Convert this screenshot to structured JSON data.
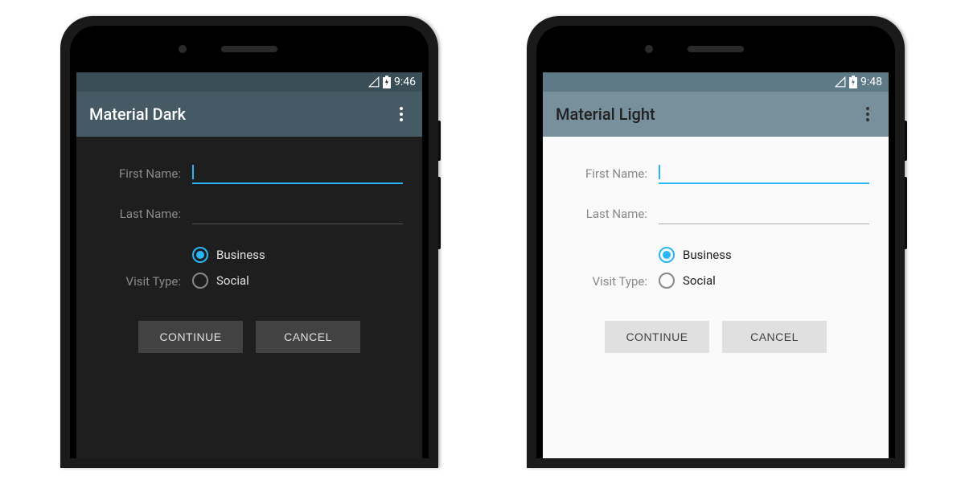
{
  "dark": {
    "statusbar": {
      "time": "9:46"
    },
    "appbar": {
      "title": "Material Dark"
    },
    "form": {
      "first_name_label": "First Name:",
      "first_name_value": "",
      "last_name_label": "Last Name:",
      "last_name_value": "",
      "visit_type_label": "Visit Type:",
      "radio_options": [
        {
          "label": "Business",
          "selected": true
        },
        {
          "label": "Social",
          "selected": false
        }
      ]
    },
    "buttons": {
      "continue": "CONTINUE",
      "cancel": "CANCEL"
    }
  },
  "light": {
    "statusbar": {
      "time": "9:48"
    },
    "appbar": {
      "title": "Material Light"
    },
    "form": {
      "first_name_label": "First Name:",
      "first_name_value": "",
      "last_name_label": "Last Name:",
      "last_name_value": "",
      "visit_type_label": "Visit Type:",
      "radio_options": [
        {
          "label": "Business",
          "selected": true
        },
        {
          "label": "Social",
          "selected": false
        }
      ]
    },
    "buttons": {
      "continue": "CONTINUE",
      "cancel": "CANCEL"
    }
  },
  "colors": {
    "accent": "#29b6f6"
  }
}
